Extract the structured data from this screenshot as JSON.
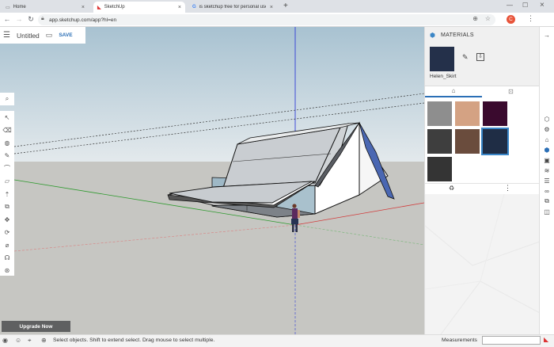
{
  "browser": {
    "tabs": [
      {
        "title": "Home",
        "active": false
      },
      {
        "title": "SketchUp",
        "active": true
      },
      {
        "title": "is sketchup free for personal use",
        "active": false
      }
    ],
    "url": "app.sketchup.com/app?hl=en",
    "profile_initial": "C"
  },
  "app": {
    "title": "Untitled",
    "save_label": "SAVE",
    "upgrade_label": "Upgrade Now"
  },
  "panel": {
    "heading": "MATERIALS",
    "material_name": "Helen_Skirt",
    "current_color": "#24304a",
    "swatches": [
      {
        "color": "#8e8e8e",
        "selected": false
      },
      {
        "color": "#d4a283",
        "selected": false
      },
      {
        "color": "#3a0a2e",
        "selected": false
      },
      {
        "color": "#3e3e3e",
        "selected": false
      },
      {
        "color": "#6a4c3d",
        "selected": false
      },
      {
        "color": "#1f2d45",
        "selected": true
      },
      {
        "color": "#343434",
        "selected": false
      }
    ]
  },
  "status": {
    "hint": "Select objects. Shift to extend select. Drag mouse to select multiple.",
    "measurements_label": "Measurements",
    "measurements_value": ""
  }
}
